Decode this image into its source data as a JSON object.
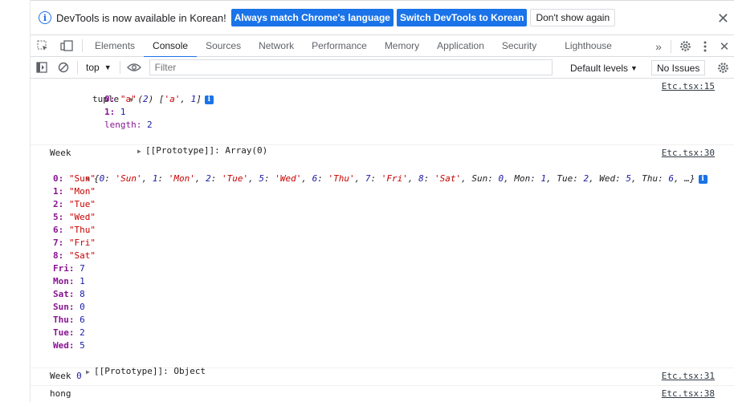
{
  "infobar": {
    "message": "DevTools is now available in Korean!",
    "btn_always": "Always match Chrome's language",
    "btn_switch": "Switch DevTools to Korean",
    "btn_dont": "Don't show again"
  },
  "tabs": [
    "Elements",
    "Console",
    "Sources",
    "Network",
    "Performance",
    "Memory",
    "Application",
    "Security",
    "Lighthouse"
  ],
  "toolbar": {
    "context": "top",
    "filter_placeholder": "Filter",
    "levels": "Default levels",
    "issues": "No Issues"
  },
  "console": {
    "m1": {
      "label": "tuple",
      "summary_head": "(2) ['a', 1]",
      "src": "Etc.tsx:15",
      "props": [
        {
          "k": "0",
          "v": "\"a\""
        },
        {
          "k": "1",
          "v": "1"
        },
        {
          "k": "length",
          "v": "2"
        }
      ],
      "proto": "[[Prototype]]: Array(0)"
    },
    "m2": {
      "label": "Week",
      "src": "Etc.tsx:30",
      "summary": "{0: 'Sun', 1: 'Mon', 2: 'Tue', 5: 'Wed', 6: 'Thu', 7: 'Fri', 8: 'Sat', Sun: 0, Mon: 1, Tue: 2, Wed: 5, Thu: 6, …}",
      "props": [
        {
          "k": "0",
          "v": "\"Sun\""
        },
        {
          "k": "1",
          "v": "\"Mon\""
        },
        {
          "k": "2",
          "v": "\"Tue\""
        },
        {
          "k": "5",
          "v": "\"Wed\""
        },
        {
          "k": "6",
          "v": "\"Thu\""
        },
        {
          "k": "7",
          "v": "\"Fri\""
        },
        {
          "k": "8",
          "v": "\"Sat\""
        },
        {
          "k": "Fri",
          "v": "7"
        },
        {
          "k": "Mon",
          "v": "1"
        },
        {
          "k": "Sat",
          "v": "8"
        },
        {
          "k": "Sun",
          "v": "0"
        },
        {
          "k": "Thu",
          "v": "6"
        },
        {
          "k": "Tue",
          "v": "2"
        },
        {
          "k": "Wed",
          "v": "5"
        }
      ],
      "proto": "[[Prototype]]: Object"
    },
    "m3": {
      "label": "Week",
      "value": "0",
      "src": "Etc.tsx:31"
    },
    "m4": {
      "label": "hong",
      "src": "Etc.tsx:38"
    }
  }
}
